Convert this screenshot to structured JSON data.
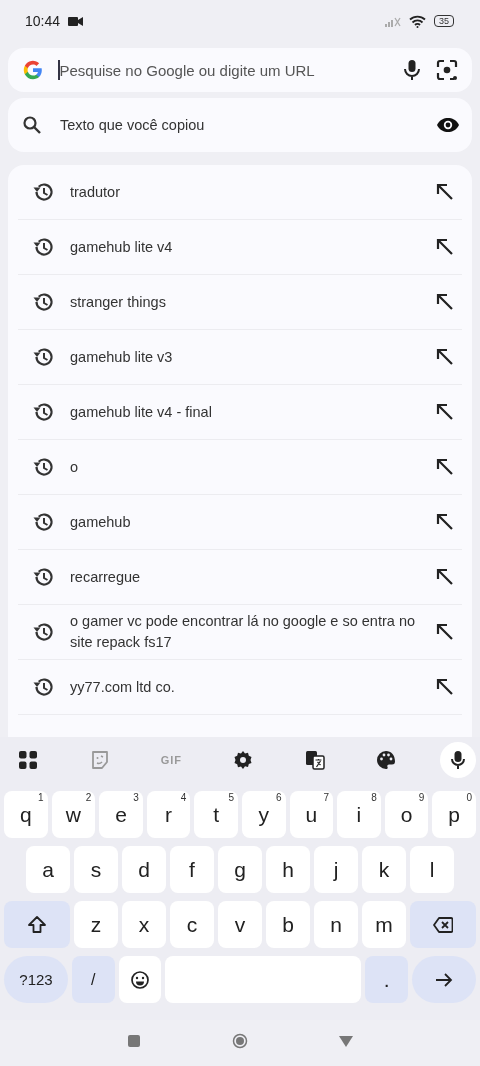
{
  "status_bar": {
    "time": "10:44",
    "battery": "35"
  },
  "search_field": {
    "placeholder": "Pesquise no Google ou digite um URL"
  },
  "clipboard_suggestion": {
    "label": "Texto que você copiou"
  },
  "history": [
    "tradutor",
    "gamehub lite v4",
    "stranger things",
    "gamehub lite v3",
    "gamehub lite v4 - final",
    "o",
    "gamehub",
    "recarregue",
    "o gamer vc pode encontrar lá no google e so entra no site repack fs17",
    "yy77.com ltd co."
  ],
  "keyboard": {
    "toolbar": [
      {
        "kind": "apps"
      },
      {
        "kind": "sticker"
      },
      {
        "kind": "gif",
        "label": "GIF"
      },
      {
        "kind": "settings"
      },
      {
        "kind": "translate"
      },
      {
        "kind": "theme"
      },
      {
        "kind": "voice"
      }
    ],
    "top_row": [
      {
        "kind": "letter",
        "label": "q",
        "hint": "1"
      },
      {
        "kind": "letter",
        "label": "w",
        "hint": "2"
      },
      {
        "kind": "letter",
        "label": "e",
        "hint": "3"
      },
      {
        "kind": "letter",
        "label": "r",
        "hint": "4"
      },
      {
        "kind": "letter",
        "label": "t",
        "hint": "5"
      },
      {
        "kind": "letter",
        "label": "y",
        "hint": "6"
      },
      {
        "kind": "letter",
        "label": "u",
        "hint": "7"
      },
      {
        "kind": "letter",
        "label": "i",
        "hint": "8"
      },
      {
        "kind": "letter",
        "label": "o",
        "hint": "9"
      },
      {
        "kind": "letter",
        "label": "p",
        "hint": "0"
      }
    ],
    "middle_row": [
      {
        "kind": "letter",
        "label": "a"
      },
      {
        "kind": "letter",
        "label": "s"
      },
      {
        "kind": "letter",
        "label": "d"
      },
      {
        "kind": "letter",
        "label": "f"
      },
      {
        "kind": "letter",
        "label": "g"
      },
      {
        "kind": "letter",
        "label": "h"
      },
      {
        "kind": "letter",
        "label": "j"
      },
      {
        "kind": "letter",
        "label": "k"
      },
      {
        "kind": "letter",
        "label": "l"
      }
    ],
    "bottom_row": [
      {
        "kind": "shift"
      },
      {
        "kind": "letter",
        "label": "z"
      },
      {
        "kind": "letter",
        "label": "x"
      },
      {
        "kind": "letter",
        "label": "c"
      },
      {
        "kind": "letter",
        "label": "v"
      },
      {
        "kind": "letter",
        "label": "b"
      },
      {
        "kind": "letter",
        "label": "n"
      },
      {
        "kind": "letter",
        "label": "m"
      },
      {
        "kind": "backspace"
      }
    ],
    "function_row": [
      {
        "kind": "symbols",
        "label": "?123"
      },
      {
        "kind": "slash",
        "label": "/"
      },
      {
        "kind": "emoji"
      },
      {
        "kind": "space"
      },
      {
        "kind": "period",
        "label": "."
      },
      {
        "kind": "enter"
      }
    ]
  },
  "nav_bar": [
    {
      "kind": "recents"
    },
    {
      "kind": "home"
    },
    {
      "kind": "back"
    }
  ]
}
